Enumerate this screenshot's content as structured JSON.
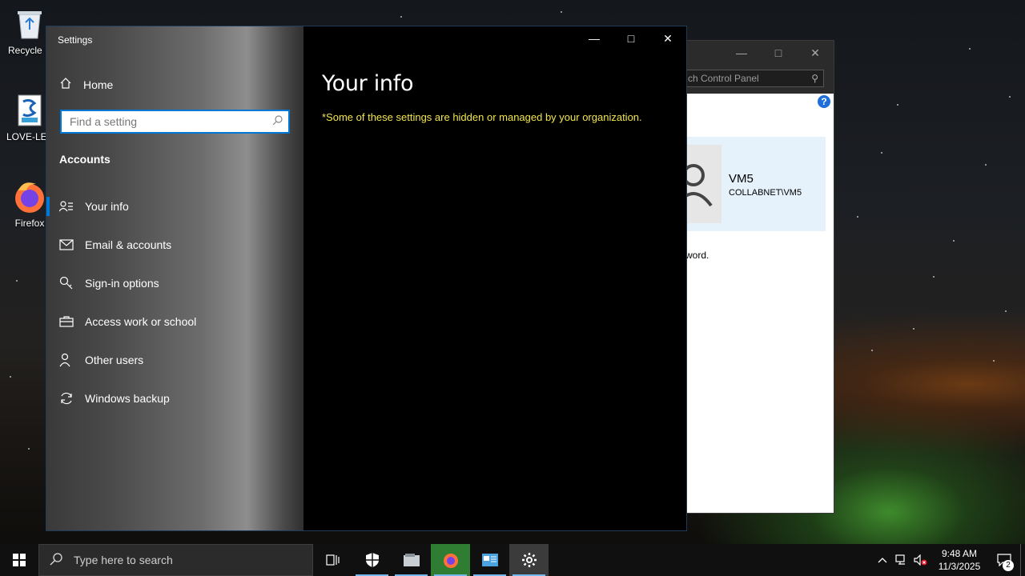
{
  "desktop": {
    "icons": [
      {
        "label": "Recycle B"
      },
      {
        "label": "LOVE-LET"
      },
      {
        "label": "Firefox"
      }
    ]
  },
  "control_panel": {
    "search_placeholder": "ch Control Panel",
    "help": "?",
    "user_name": "VM5",
    "user_domain": "COLLABNET\\VM5",
    "text_fragment": "word."
  },
  "settings": {
    "app_title": "Settings",
    "home_label": "Home",
    "search_placeholder": "Find a setting",
    "section_title": "Accounts",
    "nav_items": [
      {
        "label": "Your info",
        "icon": "person-icon"
      },
      {
        "label": "Email & accounts",
        "icon": "mail-icon"
      },
      {
        "label": "Sign-in options",
        "icon": "key-icon"
      },
      {
        "label": "Access work or school",
        "icon": "briefcase-icon"
      },
      {
        "label": "Other users",
        "icon": "add-person-icon"
      },
      {
        "label": "Windows backup",
        "icon": "sync-icon"
      }
    ],
    "page_title": "Your info",
    "org_note": "*Some of these settings are hidden or managed by your organization.",
    "accent_color": "#0078d7",
    "note_color": "#f1e44e"
  },
  "taskbar": {
    "search_placeholder": "Type here to search",
    "time": "9:48 AM",
    "date": "11/3/2025",
    "notification_count": "2"
  }
}
